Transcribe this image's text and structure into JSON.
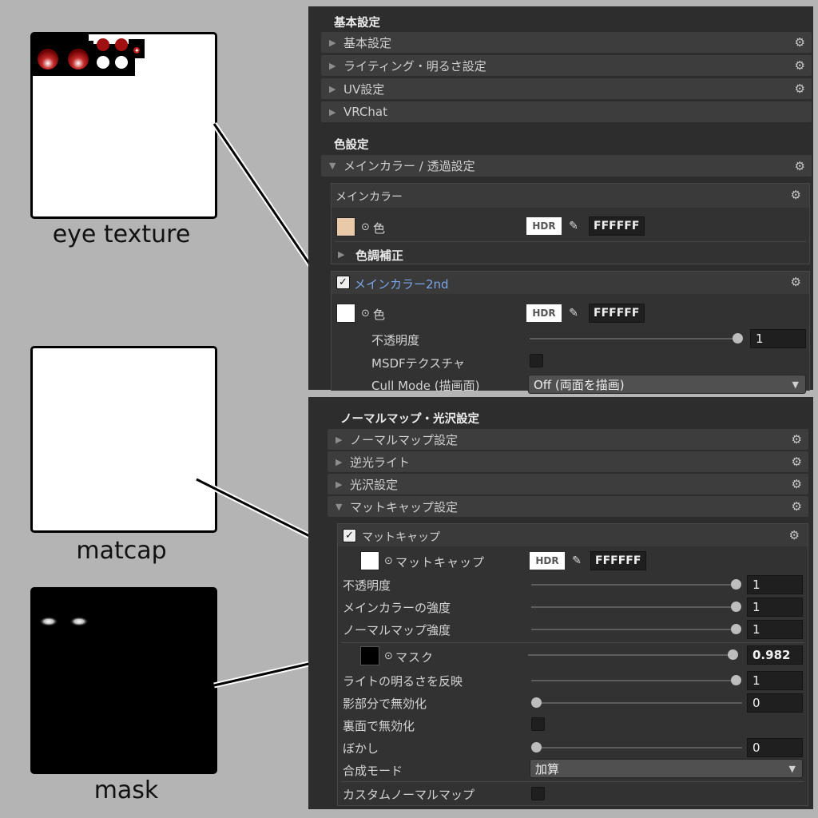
{
  "captions": {
    "eye": "eye texture",
    "matcap": "matcap",
    "mask": "mask"
  },
  "top_panel": {
    "basic_title": "基本設定",
    "basic_folds": [
      "基本設定",
      "ライティング・明るさ設定",
      "UV設定",
      "VRChat"
    ],
    "color_title": "色設定",
    "main_color_fold": "メインカラー / 透過設定",
    "main_color_box": {
      "header": "メインカラー",
      "color_label": "色",
      "hdr": "HDR",
      "hex": "FFFFFF",
      "tone_label": "色調補正"
    },
    "main2": {
      "header": "メインカラー2nd",
      "color_label": "色",
      "hdr": "HDR",
      "hex": "FFFFFF",
      "opacity_label": "不透明度",
      "opacity_value": "1",
      "opacity_level": 1.0,
      "msdf_label": "MSDFテクスチャ",
      "cull_label": "Cull Mode (描画面)",
      "cull_value": "Off (両面を描画)"
    }
  },
  "bottom_panel": {
    "title": "ノーマルマップ・光沢設定",
    "folds": [
      "ノーマルマップ設定",
      "逆光ライト",
      "光沢設定",
      "マットキャップ設定"
    ],
    "matcap": {
      "header": "マットキャップ",
      "tex_label": "マットキャップ",
      "hdr": "HDR",
      "hex": "FFFFFF",
      "rows": [
        {
          "label": "不透明度",
          "value": "1",
          "level": 1.0
        },
        {
          "label": "メインカラーの強度",
          "value": "1",
          "level": 1.0
        },
        {
          "label": "ノーマルマップ強度",
          "value": "1",
          "level": 1.0
        }
      ],
      "mask_label": "マスク",
      "mask_value": "0.982",
      "mask_level": 0.982,
      "rows2": [
        {
          "label": "ライトの明るさを反映",
          "value": "1",
          "level": 1.0
        },
        {
          "label": "影部分で無効化",
          "value": "0",
          "level": 0.0
        }
      ],
      "backface_label": "裏面で無効化",
      "blur_label": "ぼかし",
      "blur_value": "0",
      "blur_level": 0.0,
      "blend_label": "合成モード",
      "blend_value": "加算",
      "custom_normal_label": "カスタムノーマルマップ"
    }
  },
  "icons": {
    "gear": "gear-icon",
    "arrow_right": "triangle-right-icon",
    "arrow_down": "triangle-down-icon",
    "picker": "eyedropper-icon",
    "check": "checkmark-icon"
  }
}
